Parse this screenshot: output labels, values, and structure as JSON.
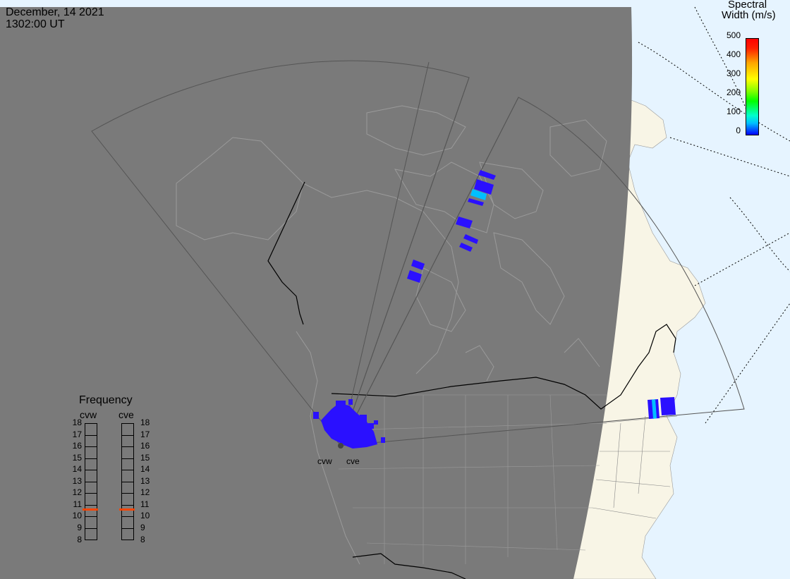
{
  "header": {
    "date": "December, 14 2021",
    "time": "1302:00 UT"
  },
  "legend": {
    "title_line1": "Spectral",
    "title_line2": "Width (m/s)",
    "ticks": [
      "500",
      "400",
      "300",
      "200",
      "100",
      "0"
    ]
  },
  "frequency_panel": {
    "title": "Frequency",
    "col_left": "cvw",
    "col_right": "cve",
    "levels": [
      "18",
      "17",
      "16",
      "15",
      "14",
      "13",
      "12",
      "11",
      "10",
      "9",
      "8"
    ],
    "cvw_value": 10.6,
    "cve_value": 10.6
  },
  "sites": {
    "west": "cvw",
    "east": "cve"
  },
  "colors": {
    "night_shade": "#7a7a7a",
    "land_day": "#f8f5e6",
    "ocean_day": "#e6f4ff",
    "data_low": "#2a10ff",
    "data_mid": "#00bfff",
    "marker": "#ff4400"
  }
}
